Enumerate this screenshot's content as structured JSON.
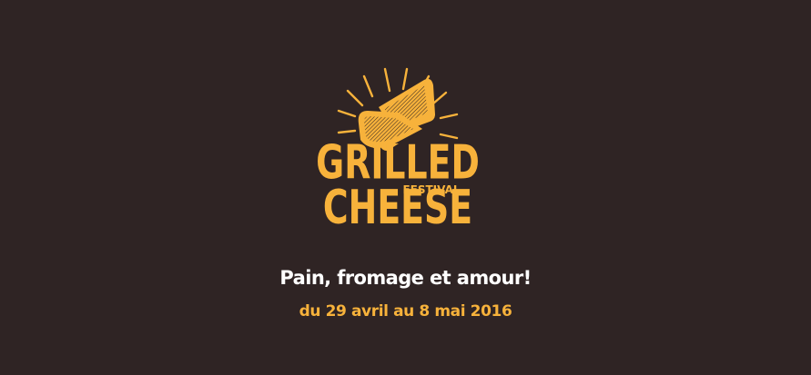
{
  "colors": {
    "background": "#2f2424",
    "accent": "#f7b23b",
    "text": "#ffffff"
  },
  "logo": {
    "icon": "grilled-cheese-sandwich-icon",
    "line1": "GRILLED",
    "line2": "FESTIVAL",
    "line3": "CHEESE"
  },
  "tagline": "Pain, fromage et amour!",
  "dates": "du 29 avril au 8 mai 2016"
}
